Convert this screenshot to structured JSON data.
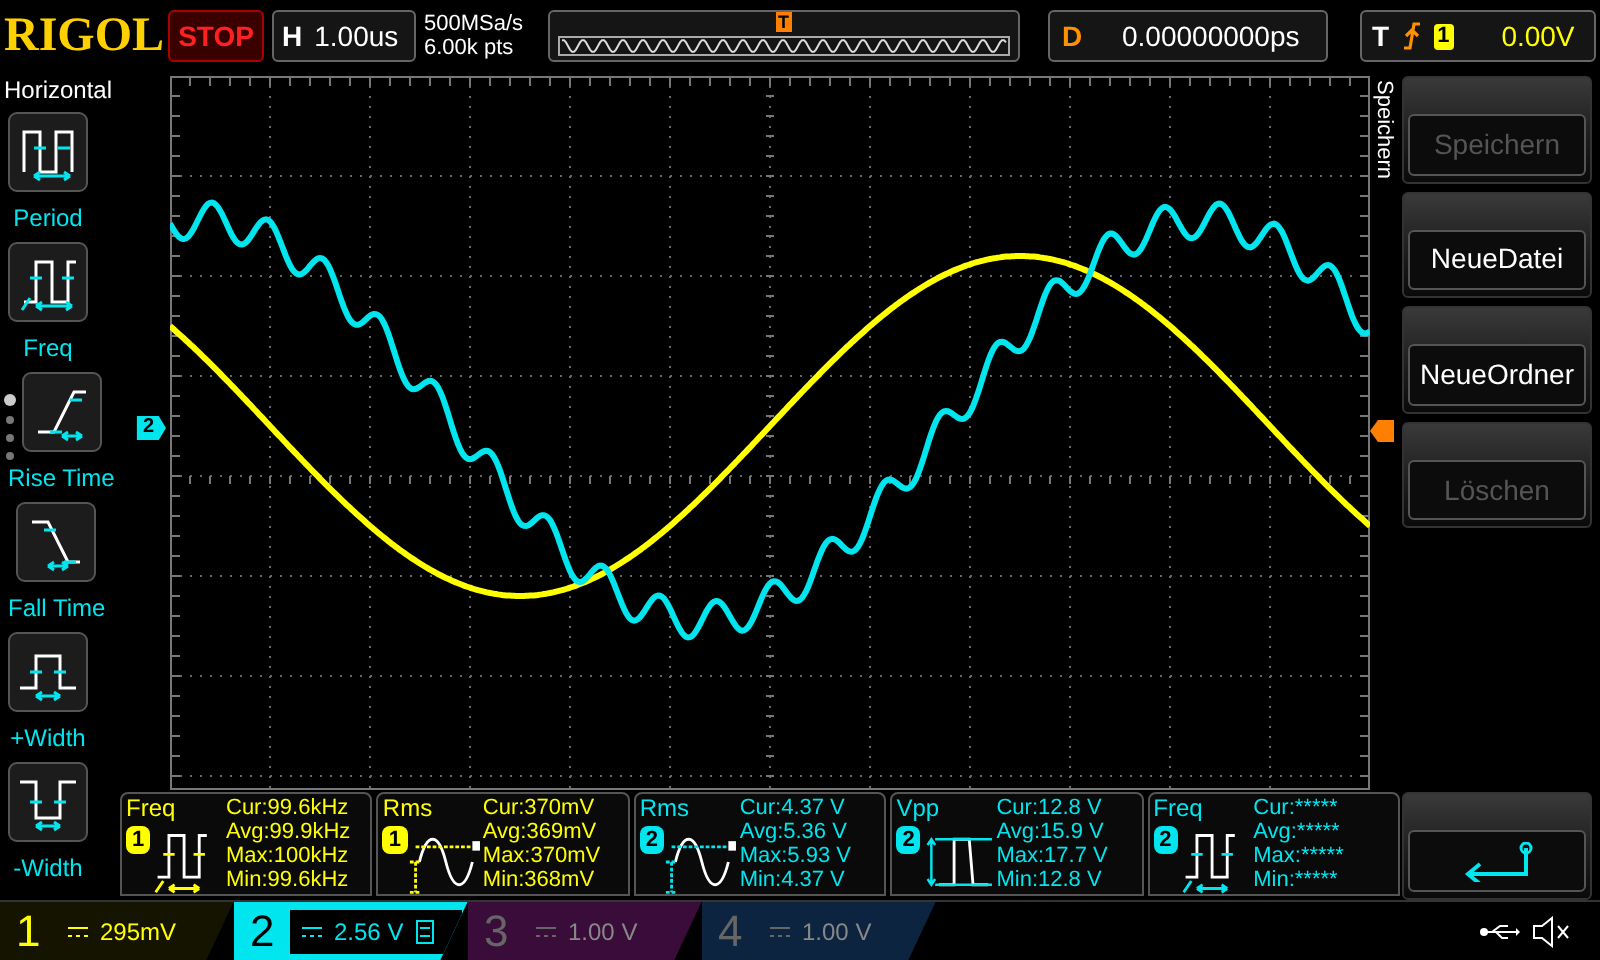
{
  "top_bar": {
    "brand": "RIGOL",
    "run_state": "STOP",
    "timebase": {
      "label": "H",
      "value": "1.00us"
    },
    "sample_rate": "500MSa/s",
    "memory_depth": "6.00k pts",
    "delay": {
      "label": "D",
      "value": "0.00000000ps"
    },
    "trigger": {
      "label": "T",
      "channel": "1",
      "level": "0.00V"
    }
  },
  "left_menu": {
    "title": "Horizontal",
    "items": [
      {
        "label": "Period",
        "kind": "period"
      },
      {
        "label": "Freq",
        "kind": "freq"
      },
      {
        "label": "Rise Time",
        "kind": "rise"
      },
      {
        "label": "Fall Time",
        "kind": "fall"
      },
      {
        "label": "+Width",
        "kind": "pwidth"
      },
      {
        "label": "-Width",
        "kind": "nwidth"
      }
    ]
  },
  "markers": {
    "trigger_position": "T",
    "channel": "2"
  },
  "right_menu": {
    "title": "Speichern",
    "items": [
      {
        "label": "Speichern",
        "disabled": true
      },
      {
        "label": "NeueDatei",
        "disabled": false
      },
      {
        "label": "NeueOrdner",
        "disabled": false
      },
      {
        "label": "Löschen",
        "disabled": true
      }
    ]
  },
  "measurements": [
    {
      "name": "Freq",
      "channel": "1",
      "color": "#ffff00",
      "kind": "freq",
      "lines": [
        "Cur:99.6kHz",
        "Avg:99.9kHz",
        "Max:100kHz",
        "Min:99.6kHz"
      ]
    },
    {
      "name": "Rms",
      "channel": "1",
      "color": "#ffff00",
      "kind": "rms",
      "lines": [
        "Cur:370mV",
        "Avg:369mV",
        "Max:370mV",
        "Min:368mV"
      ]
    },
    {
      "name": "Rms",
      "channel": "2",
      "color": "#00e5ee",
      "kind": "rms",
      "lines": [
        "Cur:4.37 V",
        "Avg:5.36 V",
        "Max:5.93 V",
        "Min:4.37 V"
      ]
    },
    {
      "name": "Vpp",
      "channel": "2",
      "color": "#00e5ee",
      "kind": "vpp",
      "lines": [
        "Cur:12.8 V",
        "Avg:15.9 V",
        "Max:17.7 V",
        "Min:12.8 V"
      ]
    },
    {
      "name": "Freq",
      "channel": "2",
      "color": "#00e5ee",
      "kind": "freq",
      "lines": [
        "Cur:*****",
        "Avg:*****",
        "Max:*****",
        "Min:*****"
      ]
    }
  ],
  "channels": [
    {
      "number": "1",
      "value": "295mV",
      "on": true,
      "selected": false,
      "limit_icon": false,
      "color": "#ffff00"
    },
    {
      "number": "2",
      "value": "2.56 V",
      "on": true,
      "selected": true,
      "limit_icon": true,
      "color": "#00e5ee"
    },
    {
      "number": "3",
      "value": "1.00 V",
      "on": false,
      "selected": false,
      "limit_icon": false,
      "color": "#3a0c3a"
    },
    {
      "number": "4",
      "value": "1.00 V",
      "on": false,
      "selected": false,
      "limit_icon": false,
      "color": "#0c2440"
    }
  ]
}
